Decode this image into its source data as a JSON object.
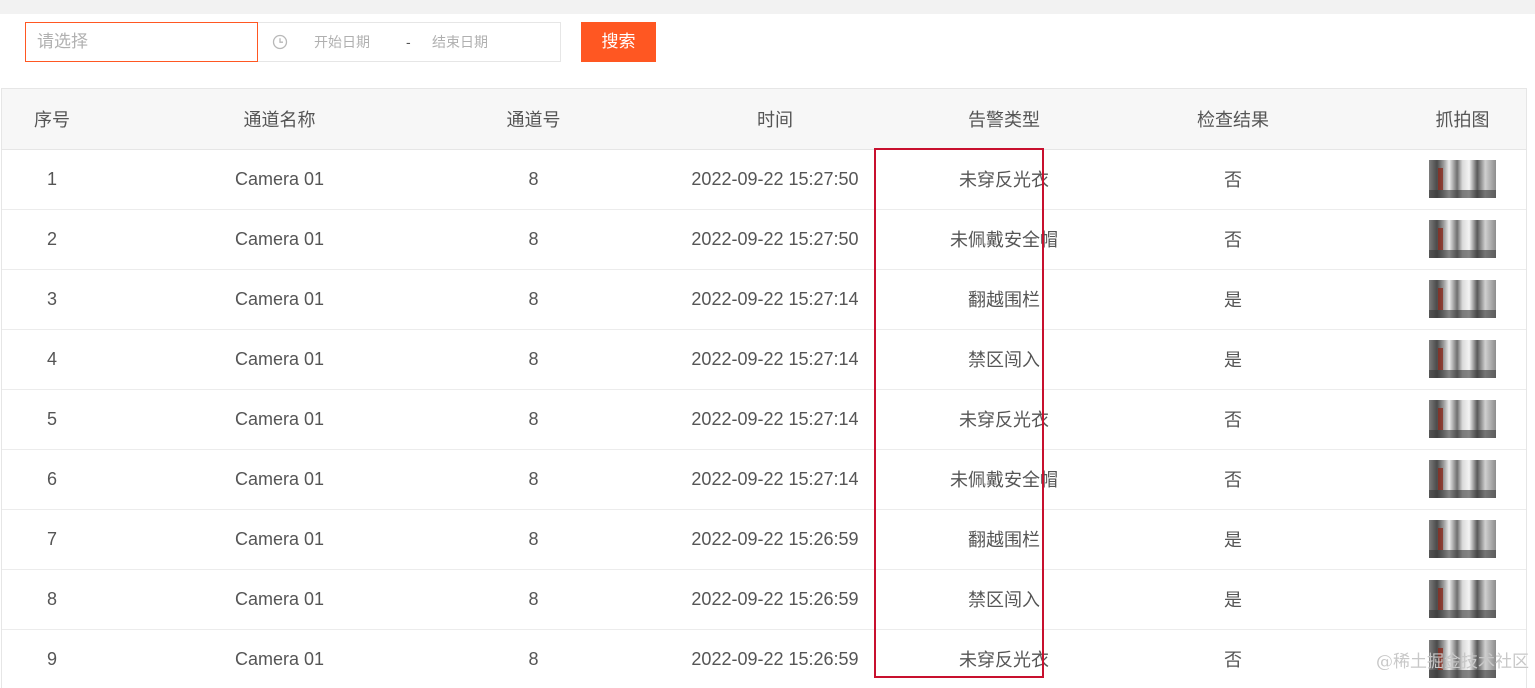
{
  "search": {
    "select_placeholder": "请选择",
    "start_placeholder": "开始日期",
    "separator": "-",
    "end_placeholder": "结束日期",
    "button_label": "搜索"
  },
  "table": {
    "columns": [
      "序号",
      "通道名称",
      "通道号",
      "时间",
      "告警类型",
      "检查结果",
      "抓拍图"
    ],
    "rows": [
      {
        "index": "1",
        "channel_name": "Camera 01",
        "channel_no": "8",
        "time": "2022-09-22 15:27:50",
        "alarm_type": "未穿反光衣",
        "result": "否"
      },
      {
        "index": "2",
        "channel_name": "Camera 01",
        "channel_no": "8",
        "time": "2022-09-22 15:27:50",
        "alarm_type": "未佩戴安全帽",
        "result": "否"
      },
      {
        "index": "3",
        "channel_name": "Camera 01",
        "channel_no": "8",
        "time": "2022-09-22 15:27:14",
        "alarm_type": "翻越围栏",
        "result": "是"
      },
      {
        "index": "4",
        "channel_name": "Camera 01",
        "channel_no": "8",
        "time": "2022-09-22 15:27:14",
        "alarm_type": "禁区闯入",
        "result": "是"
      },
      {
        "index": "5",
        "channel_name": "Camera 01",
        "channel_no": "8",
        "time": "2022-09-22 15:27:14",
        "alarm_type": "未穿反光衣",
        "result": "否"
      },
      {
        "index": "6",
        "channel_name": "Camera 01",
        "channel_no": "8",
        "time": "2022-09-22 15:27:14",
        "alarm_type": "未佩戴安全帽",
        "result": "否"
      },
      {
        "index": "7",
        "channel_name": "Camera 01",
        "channel_no": "8",
        "time": "2022-09-22 15:26:59",
        "alarm_type": "翻越围栏",
        "result": "是"
      },
      {
        "index": "8",
        "channel_name": "Camera 01",
        "channel_no": "8",
        "time": "2022-09-22 15:26:59",
        "alarm_type": "禁区闯入",
        "result": "是"
      },
      {
        "index": "9",
        "channel_name": "Camera 01",
        "channel_no": "8",
        "time": "2022-09-22 15:26:59",
        "alarm_type": "未穿反光衣",
        "result": "否"
      }
    ]
  },
  "watermark": "@稀土掘金技术社区",
  "colors": {
    "accent": "#ff5722",
    "highlight_border": "#c8102e",
    "header_bg": "#f7f7f7"
  },
  "icons": {
    "date_icon": "clock-icon",
    "snapshot": "snapshot-thumbnail"
  }
}
